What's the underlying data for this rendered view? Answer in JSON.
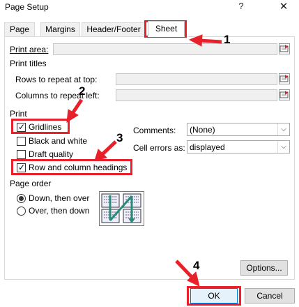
{
  "window": {
    "title": "Page Setup",
    "help": "?",
    "close": "✕"
  },
  "tabs": [
    {
      "label": "Page"
    },
    {
      "label": "Margins"
    },
    {
      "label": "Header/Footer"
    },
    {
      "label": "Sheet"
    }
  ],
  "print_area": {
    "label": "Print area:"
  },
  "print_titles": {
    "heading": "Print titles",
    "rows_label": "Rows to repeat at top:",
    "cols_label": "Columns to repeat left:"
  },
  "print": {
    "heading": "Print",
    "gridlines": "Gridlines",
    "black_white": "Black and white",
    "draft": "Draft quality",
    "headings": "Row and column headings",
    "comments_label": "Comments:",
    "comments_value": "(None)",
    "errors_label": "Cell errors as:",
    "errors_value": "displayed"
  },
  "page_order": {
    "heading": "Page order",
    "down_over": "Down, then over",
    "over_down": "Over, then down"
  },
  "buttons": {
    "options": "Options...",
    "ok": "OK",
    "cancel": "Cancel"
  },
  "annotations": {
    "n1": "1",
    "n2": "2",
    "n3": "3",
    "n4": "4",
    "color": "#e8202a"
  }
}
